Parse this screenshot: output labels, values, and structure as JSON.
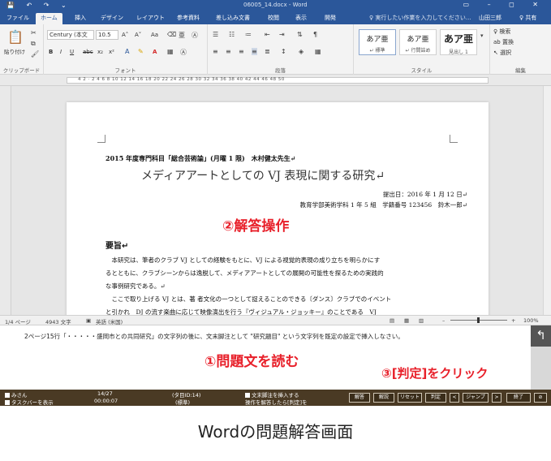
{
  "title_bar": {
    "title": "06005_14.docx - Word",
    "quick_access": "💾 ↶ ↷ ⌄",
    "window_buttons": "▭ – ◻ ✕"
  },
  "tabs": [
    {
      "label": "ファイル"
    },
    {
      "label": "ホーム"
    },
    {
      "label": "挿入"
    },
    {
      "label": "デザイン"
    },
    {
      "label": "レイアウト"
    },
    {
      "label": "参考資料"
    },
    {
      "label": "差し込み文書"
    },
    {
      "label": "校閲"
    },
    {
      "label": "表示"
    },
    {
      "label": "開発"
    }
  ],
  "tell_me": "♀ 実行したい作業を入力してください...",
  "user_name": "山田三郎",
  "share_label": "♀ 共有",
  "ribbon": {
    "clipboard": {
      "paste_label": "貼り付け",
      "group_label": "クリップボード"
    },
    "font": {
      "font_name": "Century (本文",
      "font_size": "10.5",
      "group_label": "フォント",
      "bold": "B",
      "italic": "I",
      "underline": "U",
      "strike": "abc",
      "sub": "x₂",
      "sup": "x²",
      "grow": "A˄",
      "shrink": "A˅",
      "case": "Aa",
      "color_a": "A"
    },
    "paragraph": {
      "group_label": "段落"
    },
    "styles": {
      "group_label": "スタイル",
      "items": [
        {
          "sample": "あア亜",
          "label": "↵ 標準"
        },
        {
          "sample": "あア亜",
          "label": "↵ 行間詰め"
        },
        {
          "sample": "あア亜",
          "label": "見出し 1"
        }
      ]
    },
    "editing": {
      "find": "♀ 検索",
      "replace": "ab 置換",
      "select": "↖ 選択",
      "group_label": "編集"
    }
  },
  "ruler": {
    "numbers": "4  2  ·  2  4  6  8  10  12  14  16  18  20  22  24  26  28  30  32  34  36  38  40  42  44  46  48  50"
  },
  "document": {
    "subject_line": "2015 年度専門科目「総合芸術論」(月曜 1 限)　木村健太先生↵",
    "title": "メディアアートとしての VJ 表現に関する研究↵",
    "date_line": "提出日：2016 年 1 月 12 日↵",
    "author_line": "教育学部美術学科 1 年 5 組　学籍番号 123456　鈴木一郎↵",
    "youshi": "要旨↵",
    "paragraphs": [
      "　本研究は、筆者のクラブ VJ としての経験をもとに、VJ による視覚的表現の成り立ちを明らかにす",
      "るとともに、クラブシーンからは逸脱して、メディアアートとしての展開の可能性を探るための実践的",
      "な事例研究である。↵",
      "　ここで取り上げる VJ とは、著 者文化の一つとして捉えることのできる〔ダンス〕クラブでのイベント",
      "と引かれ　DJ の流す楽曲に応じて映像演出を行う『ヴィジュアル・ジョッキー』のことである　VJ"
    ]
  },
  "callouts": {
    "step1": "①問題文を読む",
    "step2": "②解答操作",
    "step3": "③[判定]をクリック"
  },
  "status_bar": {
    "page": "1/4 ページ",
    "words": "4943 文字",
    "lang": "英語 (米国)",
    "zoom": "100%"
  },
  "question": {
    "text": "2ページ15行「・・・・・盛岡市との共同研究」の文字列の後に、文末脚注として \"研究題目\" という文字列を既定の設定で挿入しなさい。"
  },
  "exam_bar": {
    "check1": "みさん",
    "check2": "タスクバーを表示",
    "progress": "14/27",
    "time": "00:00:07",
    "task_id": "(タ目ID:14)",
    "task_type": "(標準)",
    "task_title": "文末脚注を挿入する",
    "task_note": "操作を解答したら[判定]を",
    "buttons": [
      "解答",
      "解説",
      "リセット",
      "判定",
      "<",
      "ジャンプ",
      ">",
      "終了",
      "⊘"
    ]
  },
  "caption": "Wordの問題解答画面"
}
